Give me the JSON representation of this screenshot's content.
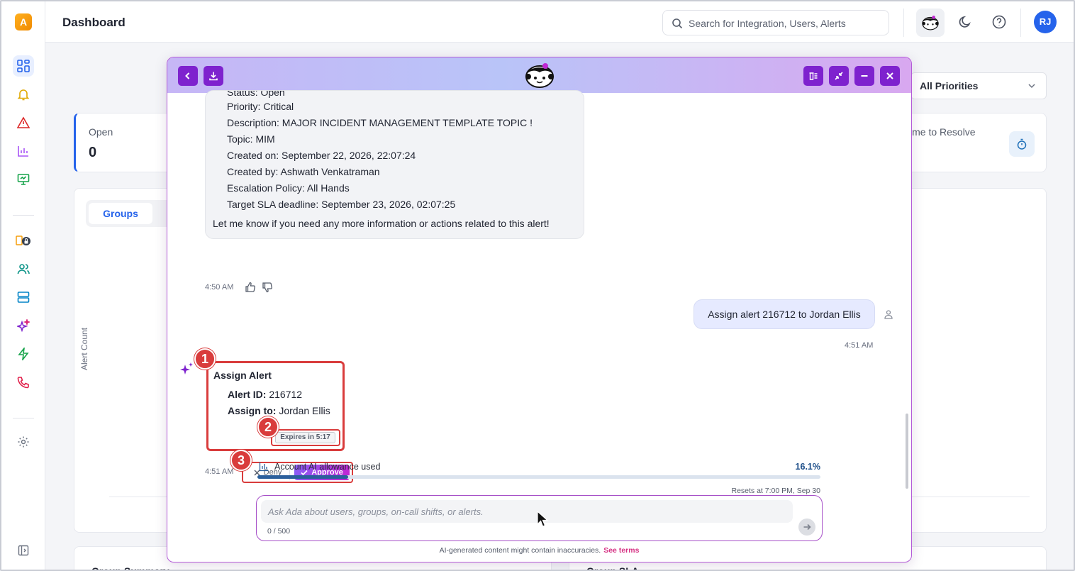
{
  "header": {
    "title": "Dashboard",
    "search_placeholder": "Search for Integration, Users, Alerts",
    "user_initials": "RJ"
  },
  "sidebar": {
    "logo": "A",
    "icons": [
      "dashboard-icon",
      "bell-icon",
      "alert-triangle-icon",
      "bar-chart-icon",
      "monitor-icon",
      "lock-integration-icon",
      "users-icon",
      "server-icon",
      "sparkles-icon",
      "lightning-icon",
      "phone-icon",
      "settings-icon",
      "collapse-sidebar-icon"
    ]
  },
  "dashboard": {
    "priority_filter": "All Priorities",
    "open_label": "Open",
    "open_value": "0",
    "ttr_label": "ime to Resolve",
    "tab_groups": "Groups",
    "yaxis_label": "Alert Count",
    "bottom_left_title": "Group Summary",
    "bottom_right_title": "Group SLA"
  },
  "chat": {
    "prev_message": {
      "status_line": "Status: Open",
      "lines": [
        "Priority: Critical",
        "Description: MAJOR INCIDENT MANAGEMENT TEMPLATE TOPIC !",
        "Topic: MIM",
        "Created on: September 22, 2026, 22:07:24",
        "Created by: Ashwath Venkatraman",
        "Escalation Policy: All Hands",
        "Target SLA deadline: September 23, 2026, 02:07:25"
      ],
      "closing": "Let me know if you need any more information or actions related to this alert!",
      "time": "4:50 AM"
    },
    "user_message": {
      "text": "Assign alert 216712 to Jordan Ellis",
      "time": "4:51 AM"
    },
    "assign_card": {
      "title": "Assign Alert",
      "alert_id_label": "Alert ID:",
      "alert_id": "216712",
      "assign_to_label": "Assign to:",
      "assign_to": "Jordan Ellis",
      "expires": "Expires in 5:17",
      "time": "4:51 AM",
      "deny": "Deny",
      "approve": "Approve"
    },
    "badges": [
      "1",
      "2",
      "3"
    ],
    "allowance": {
      "label": "Account AI allowance used",
      "percent": "16.1%",
      "fraction": 0.161,
      "reset": "Resets at 7:00 PM, Sep 30"
    },
    "input": {
      "placeholder": "Ask Ada about users, groups, on-call shifts, or alerts.",
      "counter": "0 / 500"
    },
    "disclaimer": "AI-generated content might contain inaccuracies.",
    "terms_link": "See terms"
  },
  "colors": {
    "accent_purple": "#7e22ce",
    "annotation_red": "#d93c3c",
    "primary_blue": "#2563eb"
  }
}
